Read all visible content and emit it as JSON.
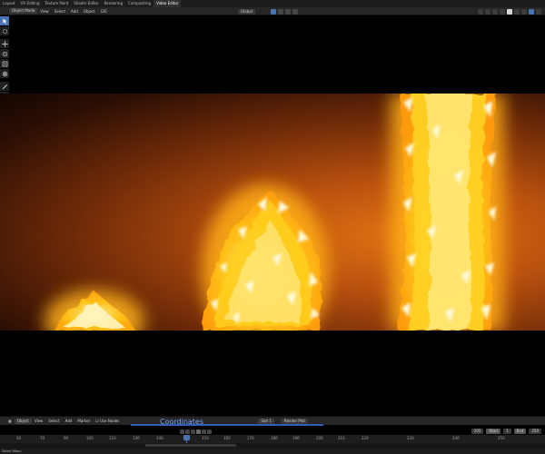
{
  "workspace_tabs": [
    "Layout",
    "UV Editing",
    "Texture Paint",
    "Shader Editor",
    "Rendering",
    "Compositing",
    "Video Editor"
  ],
  "viewport_header": {
    "mode": "Object Mode",
    "menus": [
      "View",
      "Select",
      "Add",
      "Object",
      "GIS"
    ],
    "transform_orientation": "Global"
  },
  "timeline_header": {
    "mode": "Object",
    "menus": [
      "View",
      "Select",
      "Add",
      "Marker"
    ],
    "use_nodes": "Use Nodes",
    "slot": "Slot 1",
    "image": "Render Plot",
    "caption": "Coordinates"
  },
  "frames": {
    "current": "205",
    "start_label": "Start",
    "start": "1",
    "end_label": "End",
    "end": "250"
  },
  "ruler": [
    "50",
    "70",
    "90",
    "100",
    "110",
    "130",
    "140",
    "150",
    "160",
    "170",
    "180",
    "190",
    "200",
    "210",
    "220",
    "230",
    "240",
    "250"
  ],
  "status_bar": "Select Menu",
  "colors": {
    "accent": "#4772b3",
    "fire_core": "#fff6c8",
    "fire_mid": "#ffcf1a",
    "background_glow": "#e07414"
  },
  "icons": [
    "cursor-icon",
    "cursor3d-icon",
    "move-icon",
    "rotate-icon",
    "scale-icon",
    "transform-icon",
    "annotate-icon",
    "measure-icon",
    "add-cube-icon",
    "camera-icon"
  ]
}
